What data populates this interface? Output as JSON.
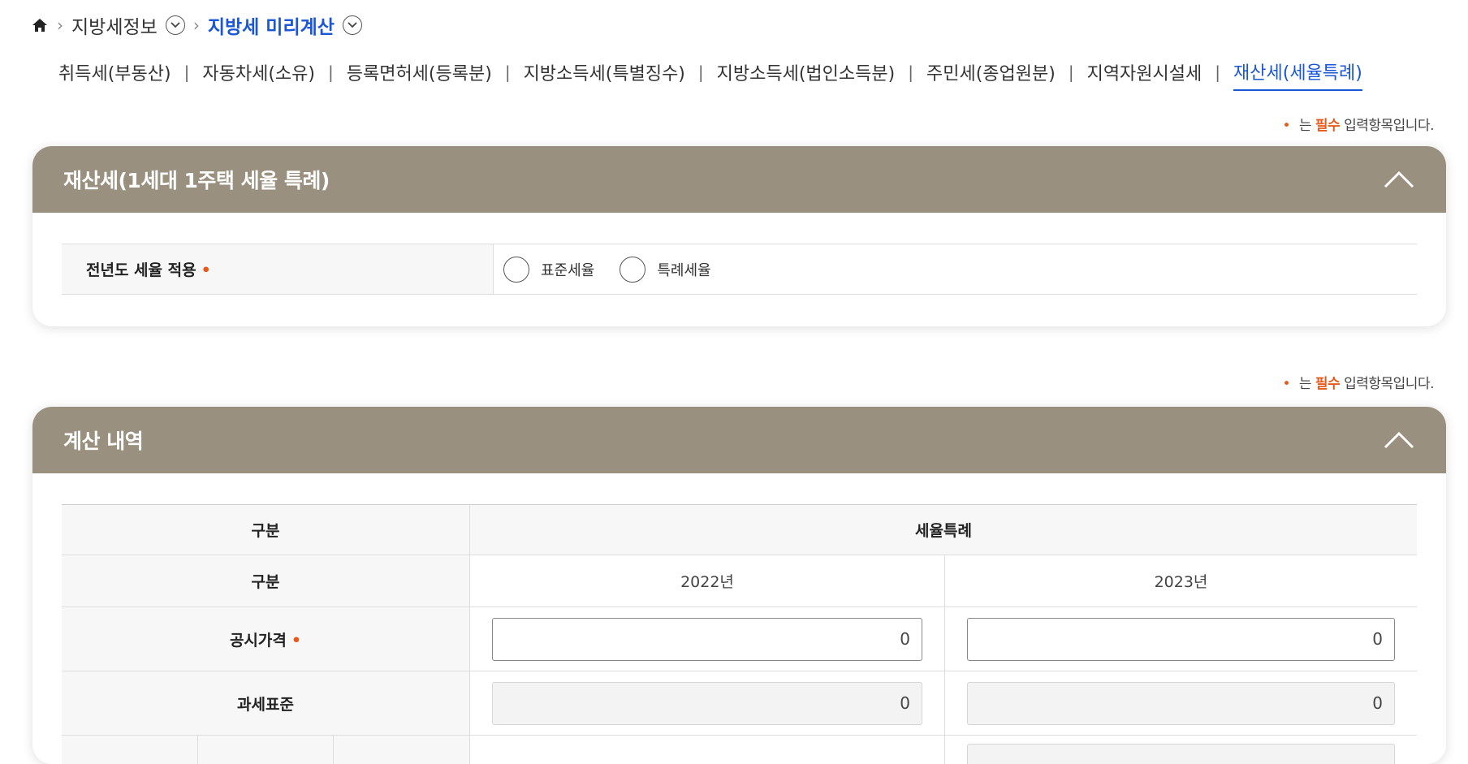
{
  "breadcrumb": {
    "home_icon": "home-icon",
    "level1": "지방세정보",
    "level2": "지방세 미리계산"
  },
  "tabs": [
    {
      "label": "취득세(부동산)",
      "active": false
    },
    {
      "label": "자동차세(소유)",
      "active": false
    },
    {
      "label": "등록면허세(등록분)",
      "active": false
    },
    {
      "label": "지방소득세(특별징수)",
      "active": false
    },
    {
      "label": "지방소득세(법인소득분)",
      "active": false
    },
    {
      "label": "주민세(종업원분)",
      "active": false
    },
    {
      "label": "지역자원시설세",
      "active": false
    },
    {
      "label": "재산세(세율특례)",
      "active": true
    }
  ],
  "required_note": {
    "prefix": "•",
    "before": " 는 ",
    "word": "필수",
    "after": " 입력항목입니다."
  },
  "section1": {
    "title": "재산세(1세대 1주택 세율 특례)",
    "row_label": "전년도 세율 적용",
    "required_mark": "•",
    "options": [
      "표준세율",
      "특례세율"
    ]
  },
  "section2": {
    "title": "계산 내역",
    "header_col1": "구분",
    "header_col2": "세율특례",
    "sub_col1": "구분",
    "year1": "2022년",
    "year2": "2023년",
    "rows": [
      {
        "label": "공시가격",
        "required": "•",
        "v1": "0",
        "v2": "0",
        "editable": true
      },
      {
        "label": "과세표준",
        "required": "",
        "v1": "0",
        "v2": "0",
        "editable": false
      }
    ]
  },
  "colors": {
    "panel_header": "#9a907f",
    "active_tab": "#1a56d6",
    "required": "#e85a1c"
  }
}
